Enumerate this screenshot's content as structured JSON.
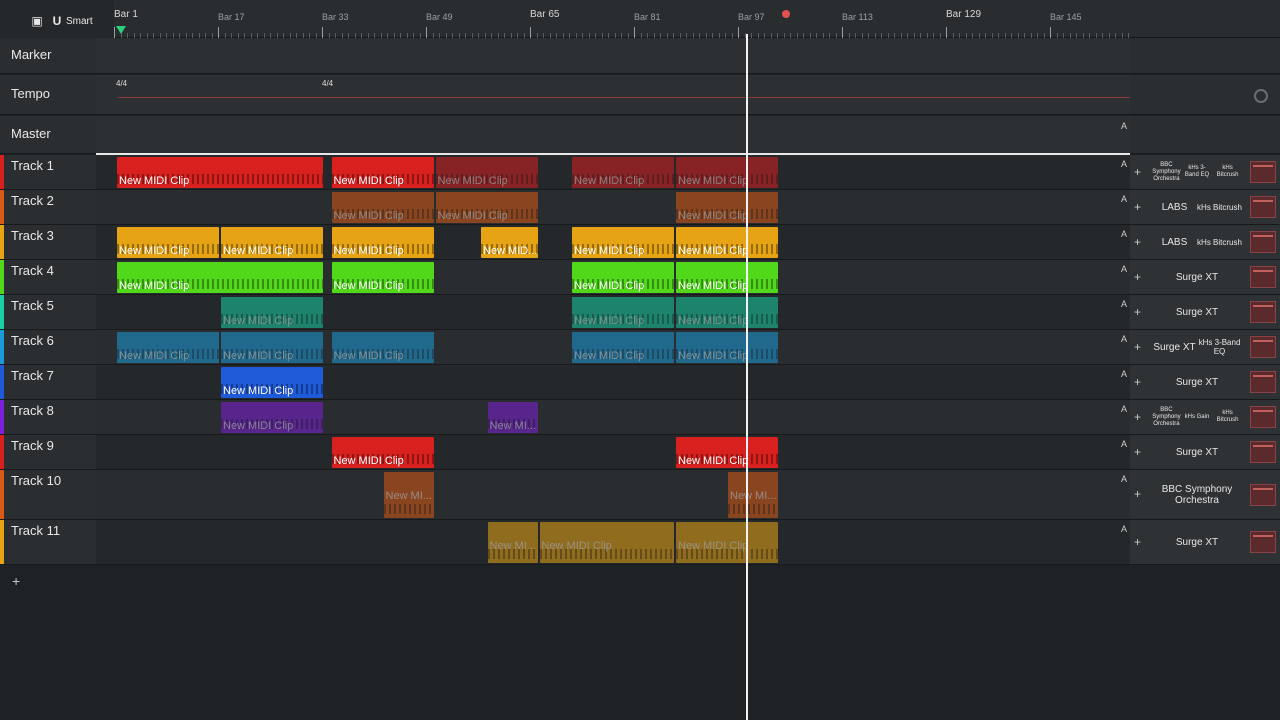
{
  "toolbar": {
    "mode_label": "Smart"
  },
  "ruler": {
    "labels": [
      {
        "text": "Bar 1",
        "bar": 1,
        "major": true
      },
      {
        "text": "Bar 17",
        "bar": 17,
        "major": false
      },
      {
        "text": "Bar 33",
        "bar": 33,
        "major": false
      },
      {
        "text": "Bar 49",
        "bar": 49,
        "major": false
      },
      {
        "text": "Bar 65",
        "bar": 65,
        "major": true
      },
      {
        "text": "Bar 81",
        "bar": 81,
        "major": false
      },
      {
        "text": "Bar 97",
        "bar": 97,
        "major": false
      },
      {
        "text": "Bar 113",
        "bar": 113,
        "major": false
      },
      {
        "text": "Bar 129",
        "bar": 129,
        "major": true
      },
      {
        "text": "Bar 145",
        "bar": 145,
        "major": false
      }
    ]
  },
  "special_tracks": [
    {
      "name": "Marker",
      "kind": "marker"
    },
    {
      "name": "Tempo",
      "kind": "tempo",
      "time_signature": "4/4"
    },
    {
      "name": "Master",
      "kind": "master"
    }
  ],
  "tracks": [
    {
      "name": "Track 1",
      "color": "#d8201f",
      "plugins": [
        "BBC Symphony Orchestra",
        "kHs 3-Band EQ",
        "kHs Bitcrush"
      ],
      "clips": [
        {
          "start": 1,
          "end": 33,
          "label": "New MIDI Clip",
          "dim": false
        },
        {
          "start": 34,
          "end": 50,
          "label": "New MIDI Clip",
          "dim": false
        },
        {
          "start": 50,
          "end": 66,
          "label": "New MIDI Clip",
          "dim": true
        },
        {
          "start": 71,
          "end": 87,
          "label": "New MIDI Clip",
          "dim": true
        },
        {
          "start": 87,
          "end": 103,
          "label": "New MIDI Clip",
          "dim": true
        }
      ]
    },
    {
      "name": "Track 2",
      "color": "#d85a14",
      "plugins": [
        "LABS",
        "kHs Bitcrush"
      ],
      "clips": [
        {
          "start": 34,
          "end": 50,
          "label": "New MIDI Clip",
          "dim": true
        },
        {
          "start": 50,
          "end": 66,
          "label": "New MIDI Clip",
          "dim": true
        },
        {
          "start": 87,
          "end": 103,
          "label": "New MIDI Clip",
          "dim": true
        }
      ]
    },
    {
      "name": "Track 3",
      "color": "#e6a414",
      "plugins": [
        "LABS",
        "kHs Bitcrush"
      ],
      "clips": [
        {
          "start": 1,
          "end": 17,
          "label": "New MIDI Clip",
          "dim": false
        },
        {
          "start": 17,
          "end": 33,
          "label": "New MIDI Clip",
          "dim": false
        },
        {
          "start": 34,
          "end": 50,
          "label": "New MIDI Clip",
          "dim": false
        },
        {
          "start": 57,
          "end": 66,
          "label": "New MID...",
          "dim": false
        },
        {
          "start": 71,
          "end": 87,
          "label": "New MIDI Clip",
          "dim": false
        },
        {
          "start": 87,
          "end": 103,
          "label": "New MIDI Clip",
          "dim": false
        }
      ]
    },
    {
      "name": "Track 4",
      "color": "#52d81a",
      "plugins": [
        "Surge XT"
      ],
      "clips": [
        {
          "start": 1,
          "end": 33,
          "label": "New MIDI Clip",
          "dim": false
        },
        {
          "start": 34,
          "end": 50,
          "label": "New MIDI Clip",
          "dim": false
        },
        {
          "start": 71,
          "end": 87,
          "label": "New MIDI Clip",
          "dim": false
        },
        {
          "start": 87,
          "end": 103,
          "label": "New MIDI Clip",
          "dim": false
        }
      ]
    },
    {
      "name": "Track 5",
      "color": "#18cfa3",
      "plugins": [
        "Surge XT"
      ],
      "clips": [
        {
          "start": 17,
          "end": 33,
          "label": "New MIDI Clip",
          "dim": true
        },
        {
          "start": 71,
          "end": 87,
          "label": "New MIDI Clip",
          "dim": true
        },
        {
          "start": 87,
          "end": 103,
          "label": "New MIDI Clip",
          "dim": true
        }
      ]
    },
    {
      "name": "Track 6",
      "color": "#1a9ad8",
      "plugins": [
        "Surge XT",
        "kHs 3-Band EQ"
      ],
      "clips": [
        {
          "start": 1,
          "end": 17,
          "label": "New MIDI Clip",
          "dim": true
        },
        {
          "start": 17,
          "end": 33,
          "label": "New MIDI Clip",
          "dim": true
        },
        {
          "start": 34,
          "end": 50,
          "label": "New MIDI Clip",
          "dim": true
        },
        {
          "start": 71,
          "end": 87,
          "label": "New MIDI Clip",
          "dim": true
        },
        {
          "start": 87,
          "end": 103,
          "label": "New MIDI Clip",
          "dim": true
        }
      ]
    },
    {
      "name": "Track 7",
      "color": "#1f5ad8",
      "plugins": [
        "Surge XT"
      ],
      "clips": [
        {
          "start": 17,
          "end": 33,
          "label": "New MIDI Clip",
          "dim": false
        }
      ]
    },
    {
      "name": "Track 8",
      "color": "#7c1fd8",
      "plugins": [
        "BBC Symphony Orchestra",
        "kHs Gain",
        "kHs Bitcrush"
      ],
      "clips": [
        {
          "start": 17,
          "end": 33,
          "label": "New MIDI Clip",
          "dim": true
        },
        {
          "start": 58,
          "end": 66,
          "label": "New MI...",
          "dim": true
        }
      ]
    },
    {
      "name": "Track 9",
      "color": "#d8201f",
      "plugins": [
        "Surge XT"
      ],
      "clips": [
        {
          "start": 34,
          "end": 50,
          "label": "New MIDI Clip",
          "dim": false
        },
        {
          "start": 87,
          "end": 103,
          "label": "New MIDI Clip",
          "dim": false
        }
      ]
    },
    {
      "name": "Track 10",
      "color": "#d85a14",
      "plugins": [
        "BBC Symphony Orchestra"
      ],
      "clips": [
        {
          "start": 42,
          "end": 50,
          "label": "New MI...",
          "dim": true
        },
        {
          "start": 95,
          "end": 103,
          "label": "New MI...",
          "dim": true
        }
      ]
    },
    {
      "name": "Track 11",
      "color": "#e6a414",
      "plugins": [
        "Surge XT"
      ],
      "clips": [
        {
          "start": 58,
          "end": 66,
          "label": "New MI...",
          "dim": true
        },
        {
          "start": 66,
          "end": 87,
          "label": "New MIDI Clip",
          "dim": true
        },
        {
          "start": 87,
          "end": 103,
          "label": "New MIDI Clip",
          "dim": true
        }
      ]
    }
  ],
  "playhead_bar": 98,
  "loop_marker_bar": 104,
  "icons": {
    "add": "+",
    "automation": "A",
    "plugin_add": "+"
  }
}
